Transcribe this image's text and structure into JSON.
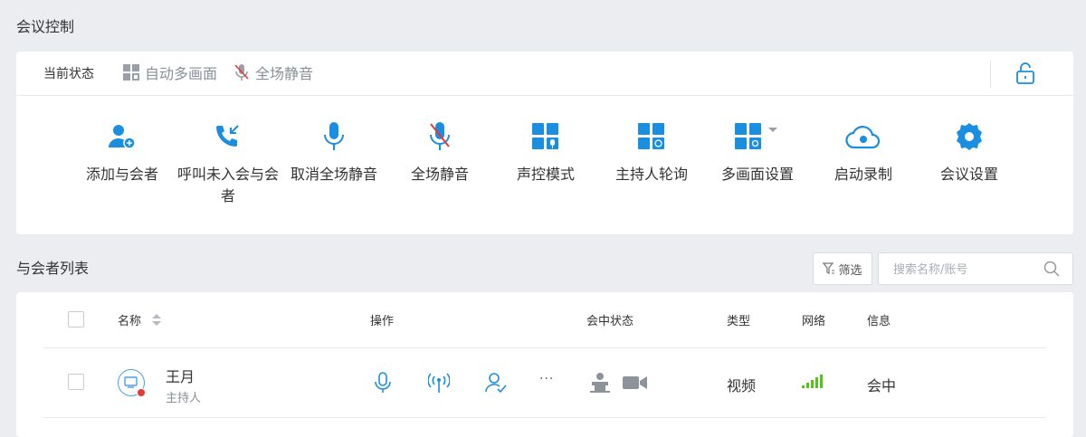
{
  "control": {
    "title": "会议控制",
    "status_label": "当前状态",
    "status_items": [
      "自动多画面",
      "全场静音"
    ],
    "actions": [
      {
        "label": "添加与会者",
        "icon": "add-participant-icon"
      },
      {
        "label": "呼叫未入会与会者",
        "icon": "call-absent-icon"
      },
      {
        "label": "取消全场静音",
        "icon": "microphone-icon"
      },
      {
        "label": "全场静音",
        "icon": "microphone-muted-icon"
      },
      {
        "label": "声控模式",
        "icon": "voice-control-layout-icon"
      },
      {
        "label": "主持人轮询",
        "icon": "host-polling-layout-icon"
      },
      {
        "label": "多画面设置",
        "icon": "multi-screen-settings-icon"
      },
      {
        "label": "启动录制",
        "icon": "cloud-record-icon"
      },
      {
        "label": "会议设置",
        "icon": "gear-icon"
      }
    ]
  },
  "participants": {
    "title": "与会者列表",
    "filter_label": "筛选",
    "search_placeholder": "搜索名称/账号",
    "columns": {
      "name": "名称",
      "operations": "操作",
      "status": "会中状态",
      "type": "类型",
      "network": "网络",
      "info": "信息"
    },
    "rows": [
      {
        "name": "王月",
        "role": "主持人",
        "type": "视频",
        "info": "会中",
        "more": "···"
      }
    ]
  },
  "colors": {
    "accent": "#1a8ee1",
    "muted_red": "#e53935",
    "network_green": "#52c41a",
    "status_gray": "#8a8f99"
  }
}
